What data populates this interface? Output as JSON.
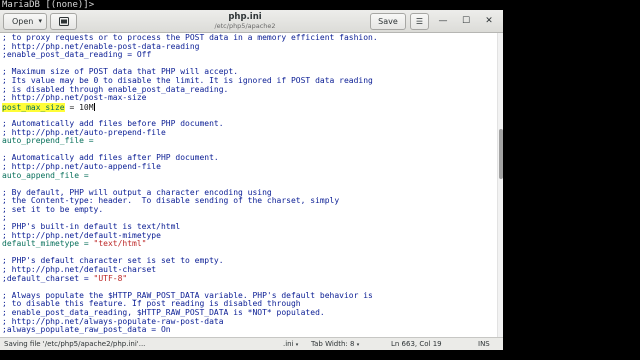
{
  "terminal": {
    "prompt": "MariaDB [(none)]>"
  },
  "window": {
    "title": "php.ini",
    "path": "/etc/php5/apache2"
  },
  "header": {
    "open_label": "Open",
    "open_caret": "▾",
    "new_tab_icon": "new-tab-icon",
    "save_label": "Save",
    "menu_icon": "☰",
    "minimize_icon": "—",
    "maximize_icon": "☐",
    "close_icon": "✕"
  },
  "editor": {
    "lines": [
      {
        "t": "; to proxy requests or to process the POST data in a memory efficient fashion.",
        "c": "comment"
      },
      {
        "t": "; http://php.net/enable-post-data-reading",
        "c": "comment"
      },
      {
        "t": ";enable_post_data_reading = Off",
        "c": "comment"
      },
      {
        "t": "",
        "c": "plain"
      },
      {
        "t": "; Maximum size of POST data that PHP will accept.",
        "c": "comment"
      },
      {
        "t": "; Its value may be 0 to disable the limit. It is ignored if POST data reading",
        "c": "comment"
      },
      {
        "t": "; is disabled through enable_post_data_reading.",
        "c": "comment"
      },
      {
        "t": "; http://php.net/post-max-size",
        "c": "comment"
      },
      {
        "t": "",
        "c": "plain"
      },
      {
        "t": "",
        "c": "plain"
      },
      {
        "t": "; Automatically add files before PHP document.",
        "c": "comment"
      },
      {
        "t": "; http://php.net/auto-prepend-file",
        "c": "comment"
      },
      {
        "t": "auto_prepend_file =",
        "c": "key"
      },
      {
        "t": "",
        "c": "plain"
      },
      {
        "t": "; Automatically add files after PHP document.",
        "c": "comment"
      },
      {
        "t": "; http://php.net/auto-append-file",
        "c": "comment"
      },
      {
        "t": "auto_append_file =",
        "c": "key"
      },
      {
        "t": "",
        "c": "plain"
      },
      {
        "t": "; By default, PHP will output a character encoding using",
        "c": "comment"
      },
      {
        "t": "; the Content-type: header.  To disable sending of the charset, simply",
        "c": "comment"
      },
      {
        "t": "; set it to be empty.",
        "c": "comment"
      },
      {
        "t": ";",
        "c": "comment"
      },
      {
        "t": "; PHP's built-in default is text/html",
        "c": "comment"
      },
      {
        "t": "; http://php.net/default-mimetype",
        "c": "comment"
      },
      {
        "t": "",
        "c": "plain"
      },
      {
        "t": "",
        "c": "plain"
      },
      {
        "t": "; PHP's default character set is set to empty.",
        "c": "comment"
      },
      {
        "t": "; http://php.net/default-charset",
        "c": "comment"
      },
      {
        "t": "",
        "c": "plain"
      },
      {
        "t": "",
        "c": "plain"
      },
      {
        "t": "; Always populate the $HTTP_RAW_POST_DATA variable. PHP's default behavior is",
        "c": "comment"
      },
      {
        "t": "; to disable this feature. If post reading is disabled through",
        "c": "comment"
      },
      {
        "t": "; enable_post_data_reading, $HTTP_RAW_POST_DATA is *NOT* populated.",
        "c": "comment"
      },
      {
        "t": "; http://php.net/always-populate-raw-post-data",
        "c": "comment"
      },
      {
        "t": ";always_populate_raw_post_data = On",
        "c": "comment"
      }
    ],
    "post_max_size_key": "post_max_size",
    "post_max_size_eq": " = ",
    "post_max_size_value": "10M",
    "default_mimetype_key": "default_mimetype = ",
    "default_mimetype_value": "\"text/html\"",
    "default_charset_key": ";default_charset = ",
    "default_charset_value": "\"UTF-8\""
  },
  "status": {
    "message": "Saving file '/etc/php5/apache2/php.ini'...",
    "filetype": ".ini",
    "tab_width": "Tab Width: 8",
    "position": "Ln 663, Col 19",
    "mode": "INS",
    "caret": "▾"
  }
}
